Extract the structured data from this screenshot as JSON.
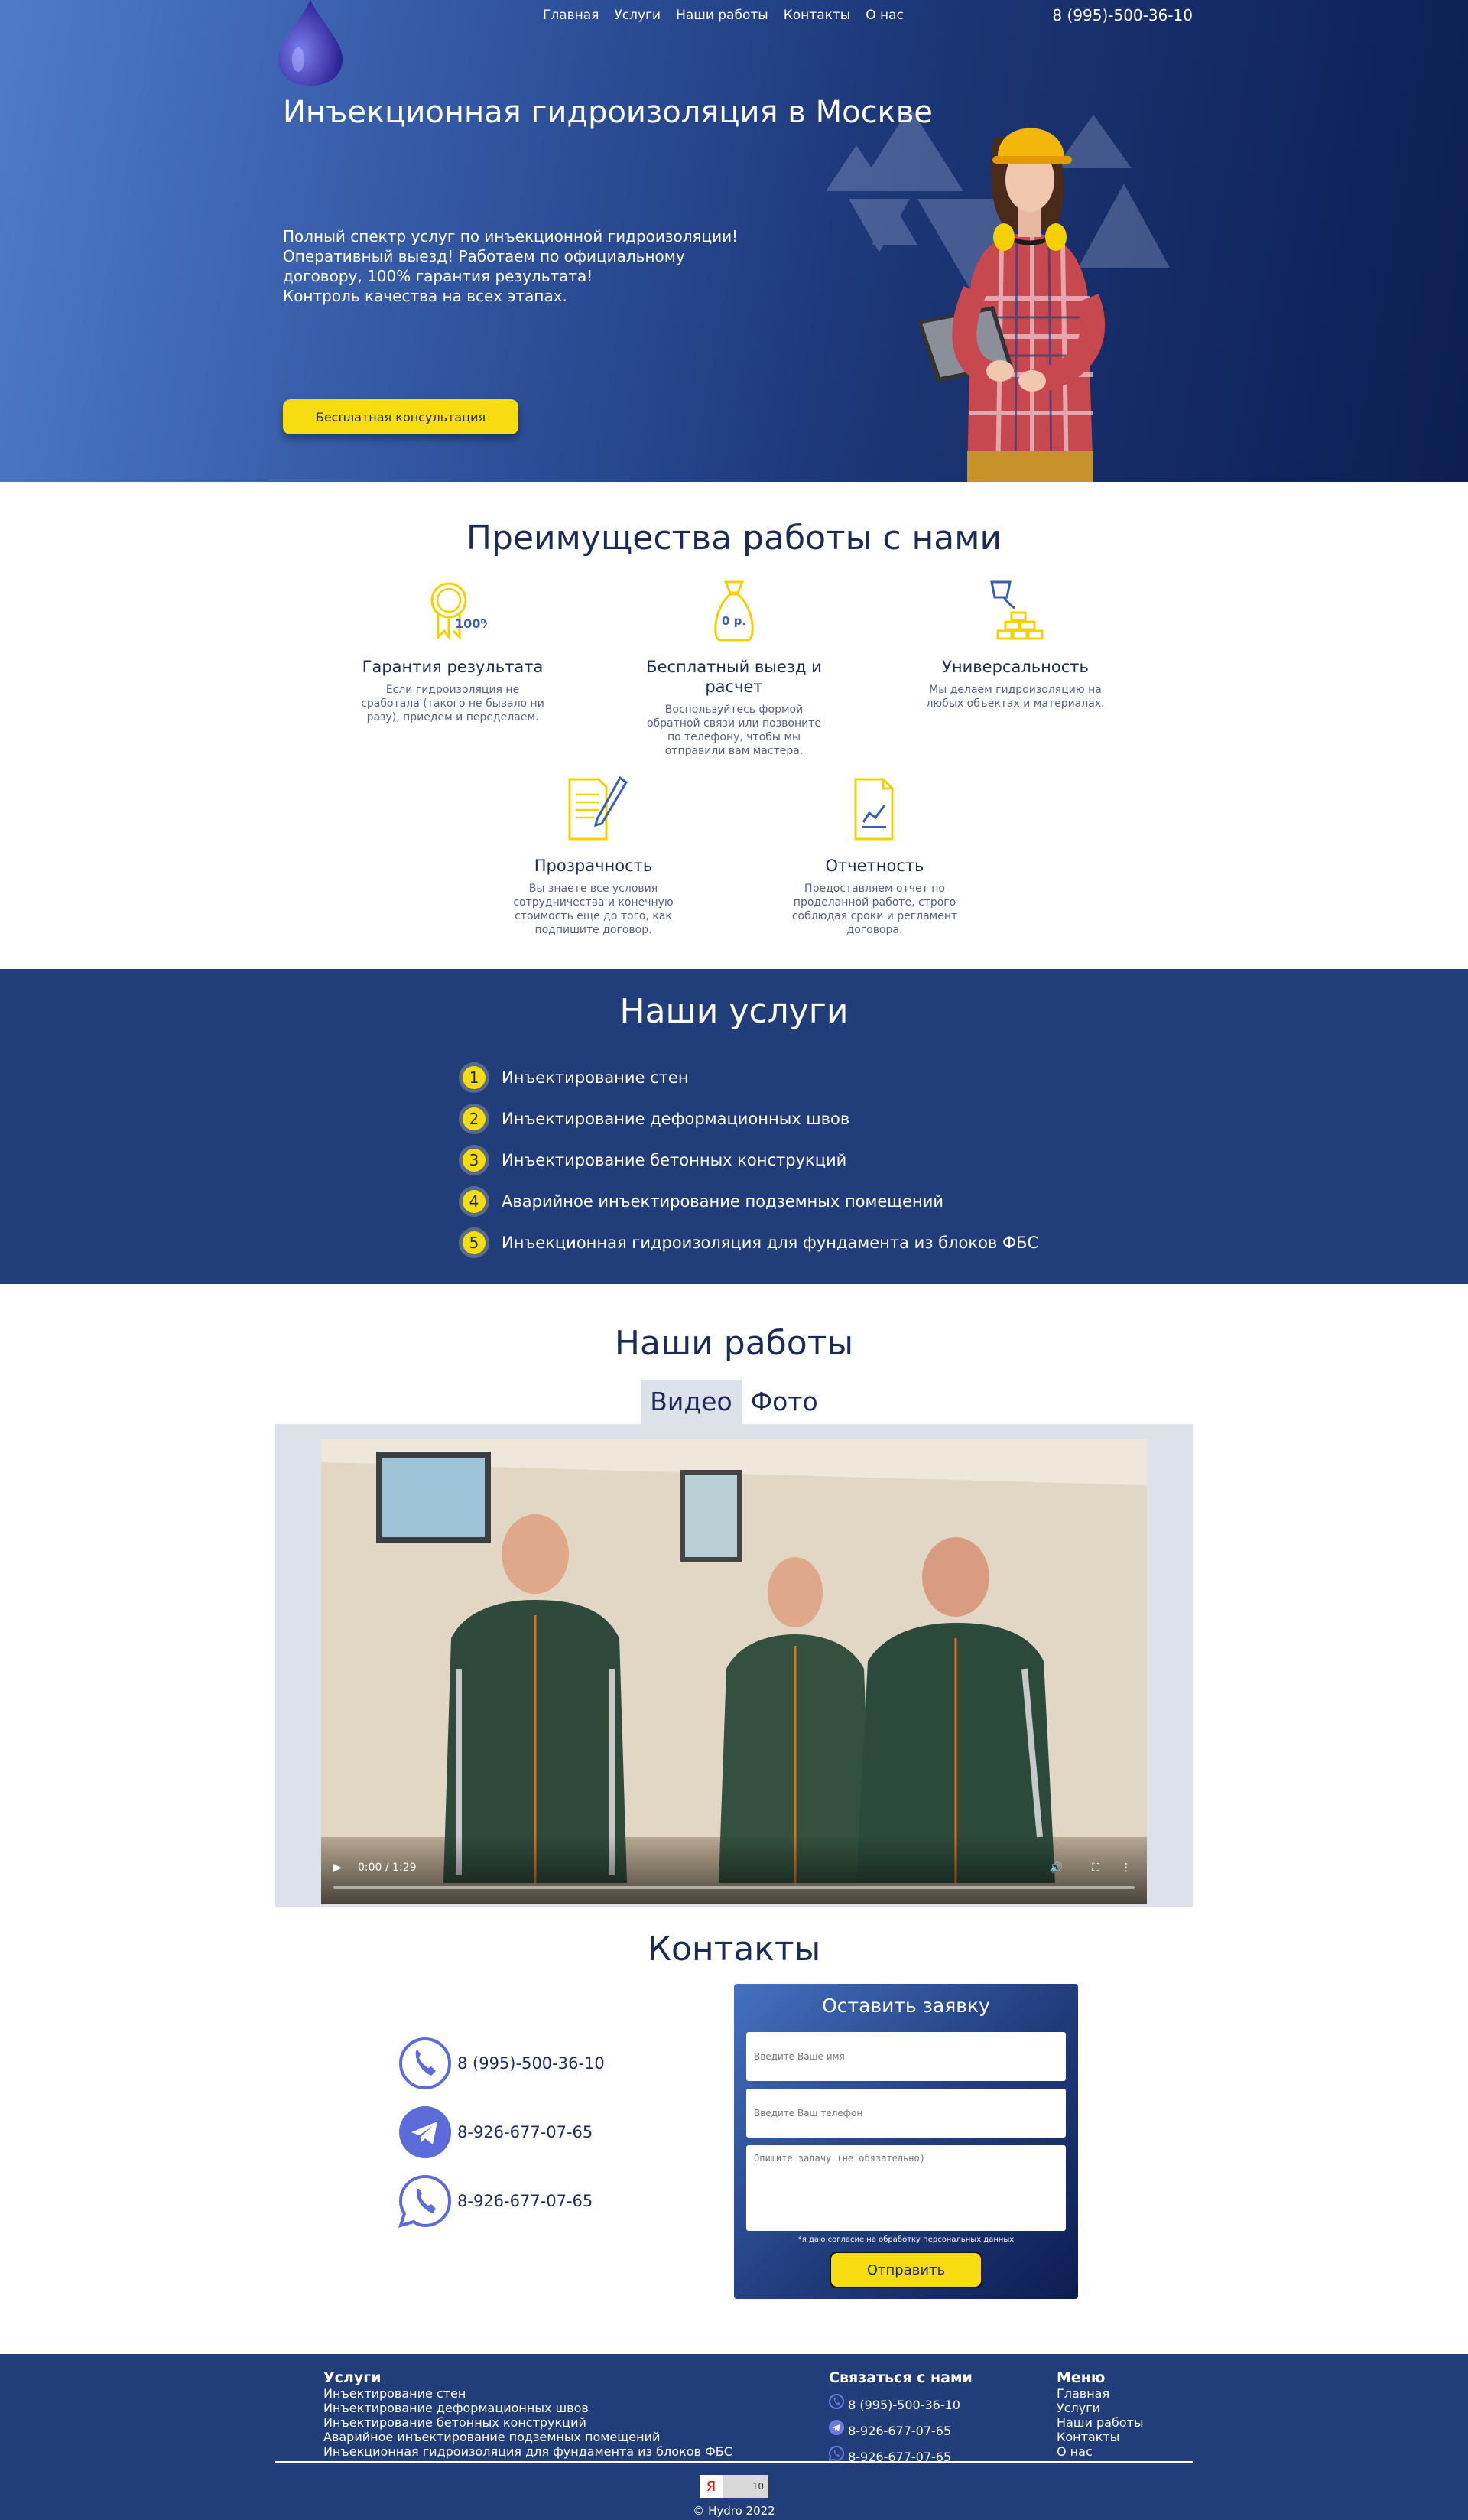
{
  "header": {
    "nav": [
      "Главная",
      "Услуги",
      "Наши работы",
      "Контакты",
      "О нас"
    ],
    "phone": "8 (995)-500-36-10"
  },
  "hero": {
    "title": "Инъекционная гидроизоляция в Москве",
    "lead": [
      "Полный спектр услуг по инъекционной гидроизоляции!",
      "Оперативный выезд! Работаем по официальному",
      "договору, 100% гарантия результата!",
      "Контроль качества на всех этапах."
    ],
    "cta": "Бесплатная консультация"
  },
  "advantages": {
    "title": "Преимущества работы с нами",
    "items": [
      {
        "icon": "award-ribbon-icon",
        "badge": "100%",
        "title": "Гарантия результата",
        "text": "Если гидроизоляция не сработала (такого не бывало ни разу), приедем и переделаем."
      },
      {
        "icon": "money-bag-icon",
        "badge": "0 р.",
        "title": "Бесплатный выезд и расчет",
        "text": "Воспользуйтесь формой обратной связи или позвоните по телефону, чтобы мы отправили вам мастера."
      },
      {
        "icon": "bricks-bucket-icon",
        "title": "Универсальность",
        "text": "Мы делаем гидроизоляцию на любых объектах и материалах."
      },
      {
        "icon": "document-pen-icon",
        "title": "Прозрачность",
        "text": "Вы знаете все условия сотрудничества и конечную стоимость еще до того, как подпишите договор."
      },
      {
        "icon": "report-chart-icon",
        "title": "Отчетность",
        "text": "Предоставляем отчет по проделанной работе, строго соблюдая сроки и регламент договора."
      }
    ]
  },
  "services": {
    "title": "Наши услуги",
    "items": [
      {
        "num": "1",
        "label": "Инъектирование стен"
      },
      {
        "num": "2",
        "label": "Инъектирование деформационных швов"
      },
      {
        "num": "3",
        "label": "Инъектирование бетонных конструкций"
      },
      {
        "num": "4",
        "label": "Аварийное инъектирование подземных помещений"
      },
      {
        "num": "5",
        "label": "Инъекционная гидроизоляция для фундамента из блоков ФБС"
      }
    ]
  },
  "works": {
    "title": "Наши работы",
    "tabs": [
      "Видео",
      "Фото"
    ],
    "active_tab": "Видео",
    "video_time": "0:00 / 1:29",
    "progress": 0
  },
  "contacts": {
    "title": "Контакты",
    "items": [
      {
        "icon": "phone-icon",
        "text": "8 (995)-500-36-10"
      },
      {
        "icon": "telegram-icon",
        "text": "8-926-677-07-65"
      },
      {
        "icon": "whatsapp-icon",
        "text": "8-926-677-07-65"
      }
    ],
    "form": {
      "title": "Оставить заявку",
      "name_placeholder": "Введите Ваше имя",
      "phone_placeholder": "Введите Ваш телефон",
      "task_placeholder": "Опишите задачу (не обязательно)",
      "agree": "*я даю согласие на обработку персональных данных",
      "submit": "Отправить"
    }
  },
  "footer": {
    "services_title": "Услуги",
    "services": [
      "Инъектирование стен",
      "Инъектирование деформационных швов",
      "Инъектирование бетонных конструкций",
      "Аварийное инъектирование подземных помещений",
      "Инъекционная гидроизоляция для фундамента из блоков ФБС"
    ],
    "contact_title": "Связаться с нами",
    "contacts": [
      "8 (995)-500-36-10",
      "8-926-677-07-65",
      "8-926-677-07-65"
    ],
    "menu_title": "Меню",
    "menu": [
      "Главная",
      "Услуги",
      "Наши работы",
      "Контакты",
      "О нас"
    ],
    "counter_logo": "Я",
    "counter_value": "10",
    "copyright": "© Hydro 2022"
  },
  "colors": {
    "accent": "#f7dc12",
    "navy": "#213e7a",
    "text": "#1c2b55"
  }
}
